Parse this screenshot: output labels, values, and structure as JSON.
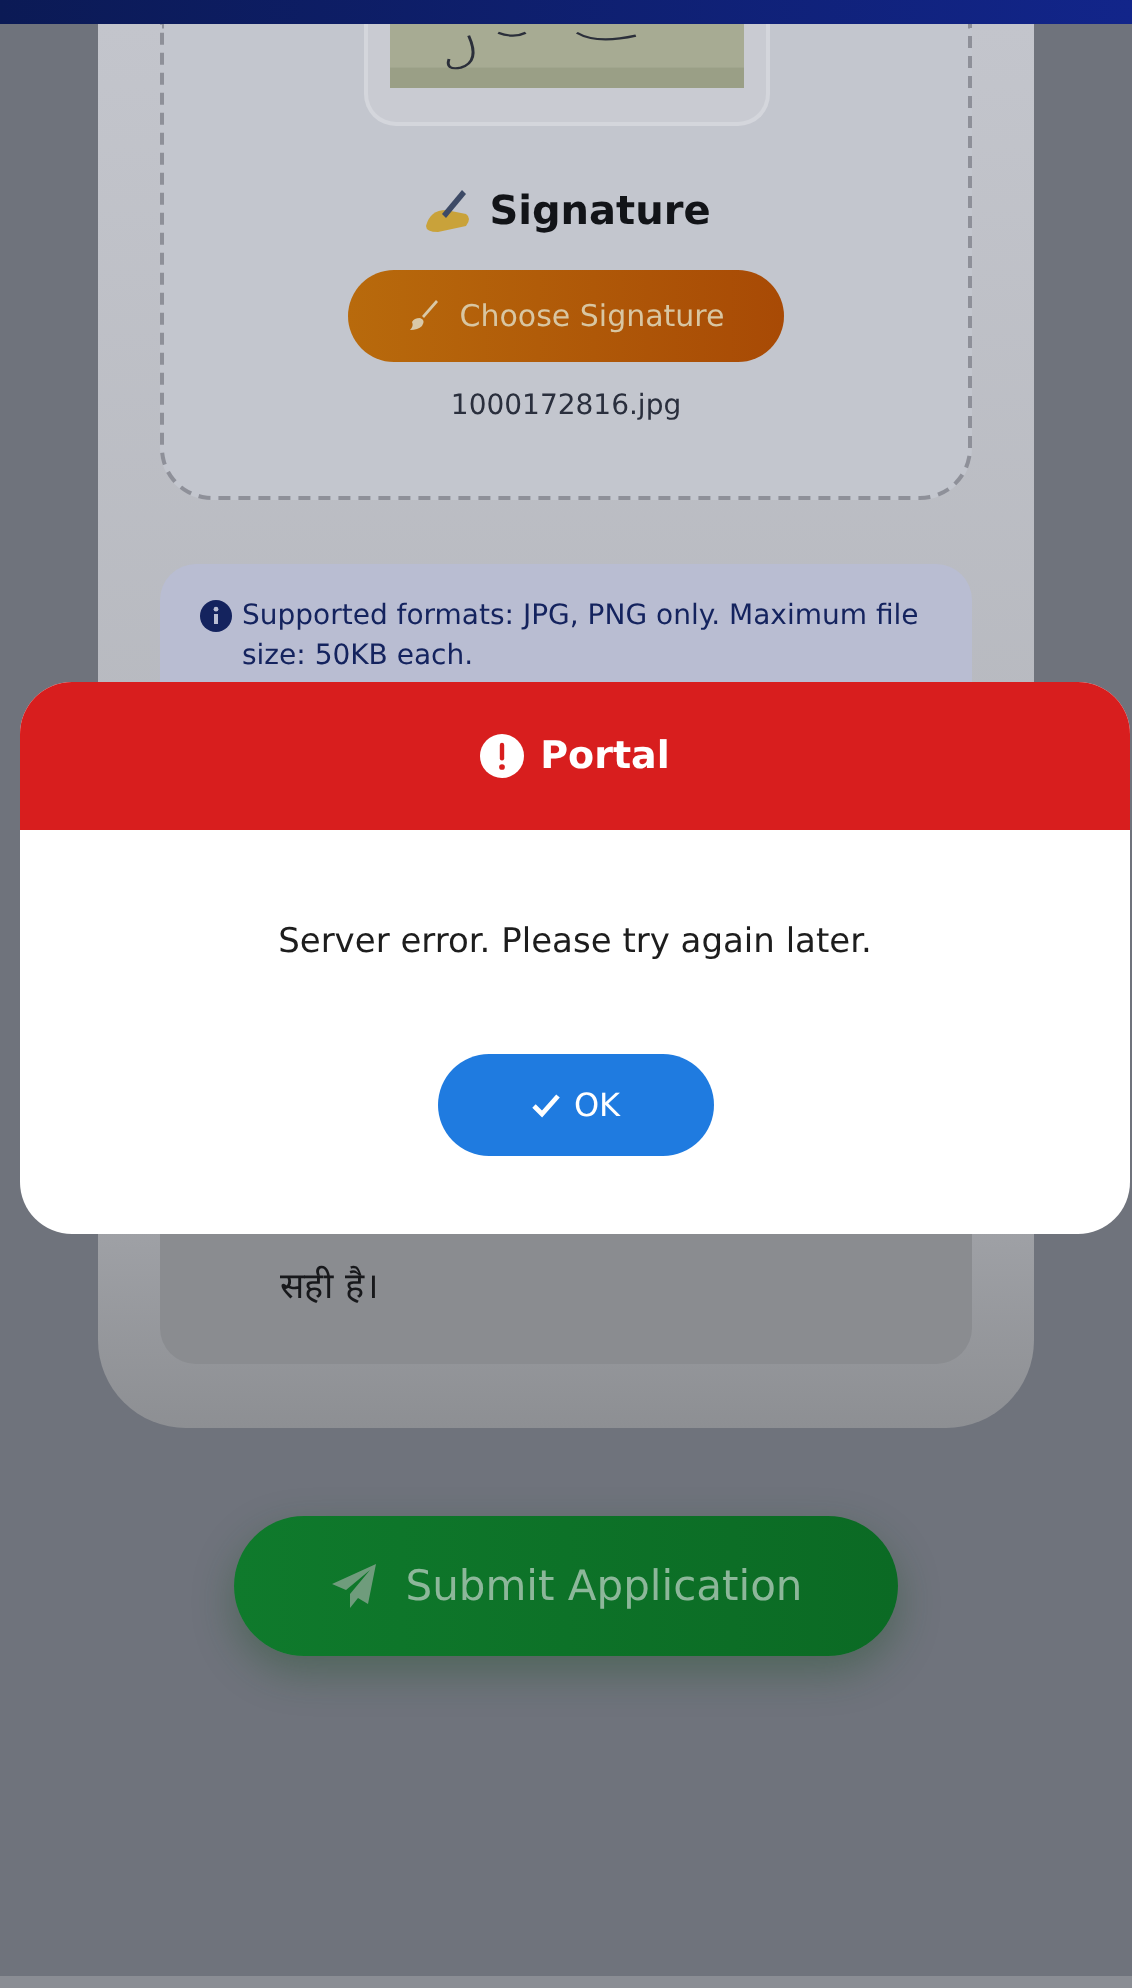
{
  "upload": {
    "heading": "Signature",
    "button": "Choose Signature",
    "file_name": "1000172816.jpg"
  },
  "info_note": "Supported formats: JPG, PNG only. Maximum file size: 50KB each.",
  "declaration": {
    "text": "सही है।"
  },
  "submit_button": "Submit Application",
  "dialog": {
    "title": "Portal",
    "message": "Server error. Please try again later.",
    "button": "OK"
  }
}
